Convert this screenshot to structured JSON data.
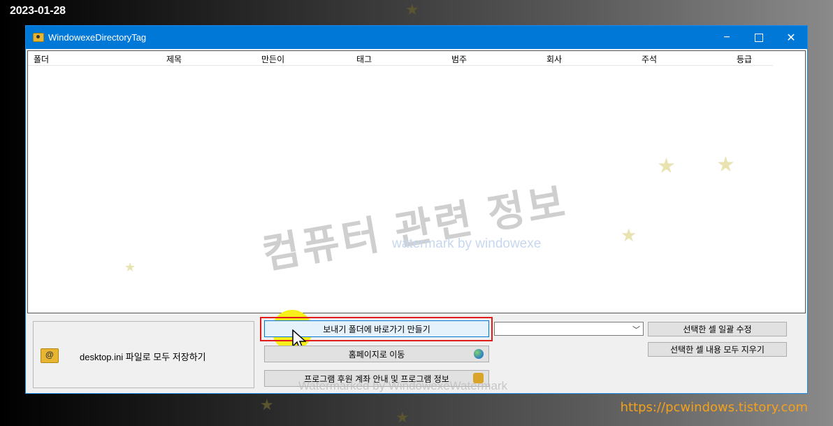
{
  "overlay": {
    "date": "2023-01-28",
    "url": "https://pcwindows.tistory.com"
  },
  "window": {
    "title": "WindowexeDirectoryTag",
    "icon": "folder-icon",
    "controls": {
      "minimize": "−",
      "close": "✕"
    }
  },
  "listview": {
    "columns": [
      "폴더",
      "제목",
      "만든이",
      "태그",
      "범주",
      "회사",
      "주석",
      "등급"
    ]
  },
  "watermark": {
    "main": "컴퓨터 관련 정보",
    "sub": "watermark by windowexe",
    "bottom": "Watermarked by WindowexeWatermark"
  },
  "save_group": {
    "label": "desktop.ini 파일로 모두 저장하기",
    "icon": "folder-at-icon"
  },
  "buttons": {
    "export_shortcut": "보내기 폴더에 바로가기 만들기",
    "homepage": "홈페이지로 이동",
    "program_info": "프로그램 후원 계좌 안내 및 프로그램 정보",
    "edit_selected": "선택한 셀 일괄 수정",
    "clear_selected": "선택한 셀 내용 모두 지우기"
  },
  "combo": {
    "value": ""
  },
  "colors": {
    "titlebar": "#0078d7",
    "highlight": "#e21b1b",
    "url": "#f4a21b"
  }
}
